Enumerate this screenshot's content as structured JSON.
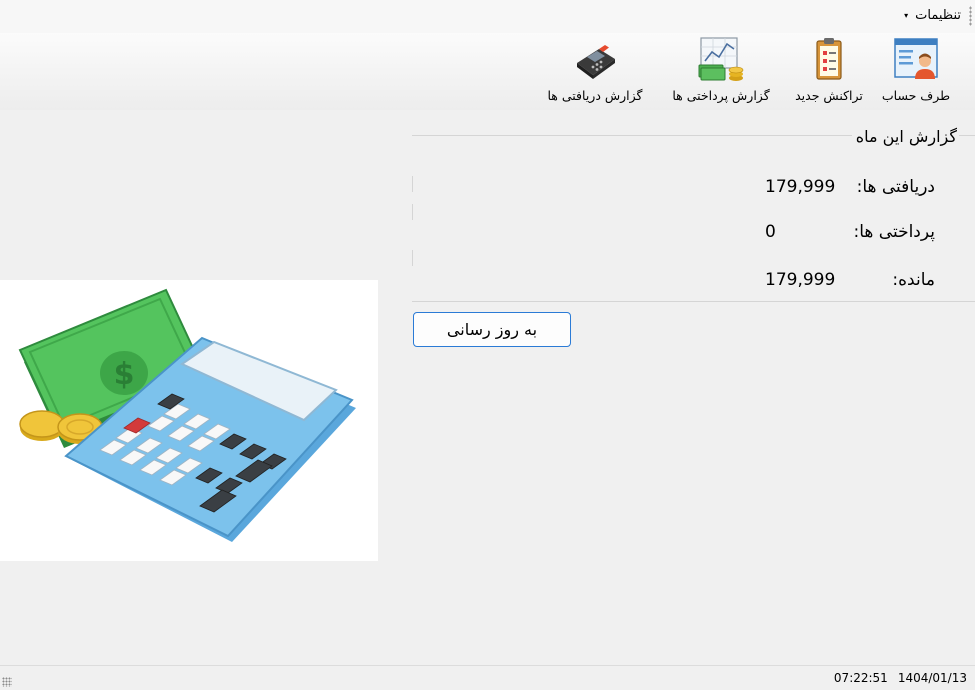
{
  "menubar": {
    "settings_label": "تنظیمات",
    "caret": "▾"
  },
  "toolbar": {
    "items": [
      {
        "label": "طرف حساب",
        "icon": "contact-card-icon"
      },
      {
        "label": "تراکنش جدید",
        "icon": "clipboard-icon"
      },
      {
        "label": "گزارش پرداختی ها",
        "icon": "chart-money-icon"
      },
      {
        "label": "گزارش دریافتی ها",
        "icon": "card-reader-icon"
      }
    ]
  },
  "report": {
    "title": "گزارش این ماه",
    "rows": [
      {
        "label": "دریافتی ها:",
        "value": "179,999"
      },
      {
        "label": "پرداختی ها:",
        "value": "0"
      },
      {
        "label": "مانده:",
        "value": "179,999"
      }
    ]
  },
  "refresh_button": {
    "label": "به روز رسانی"
  },
  "picture": {
    "icon": "calculator-money-illustration"
  },
  "statusbar": {
    "date": "1404/01/13",
    "time": "07:22:51"
  },
  "colors": {
    "accent": "#2b7bd6",
    "background": "#f0f0f0"
  }
}
